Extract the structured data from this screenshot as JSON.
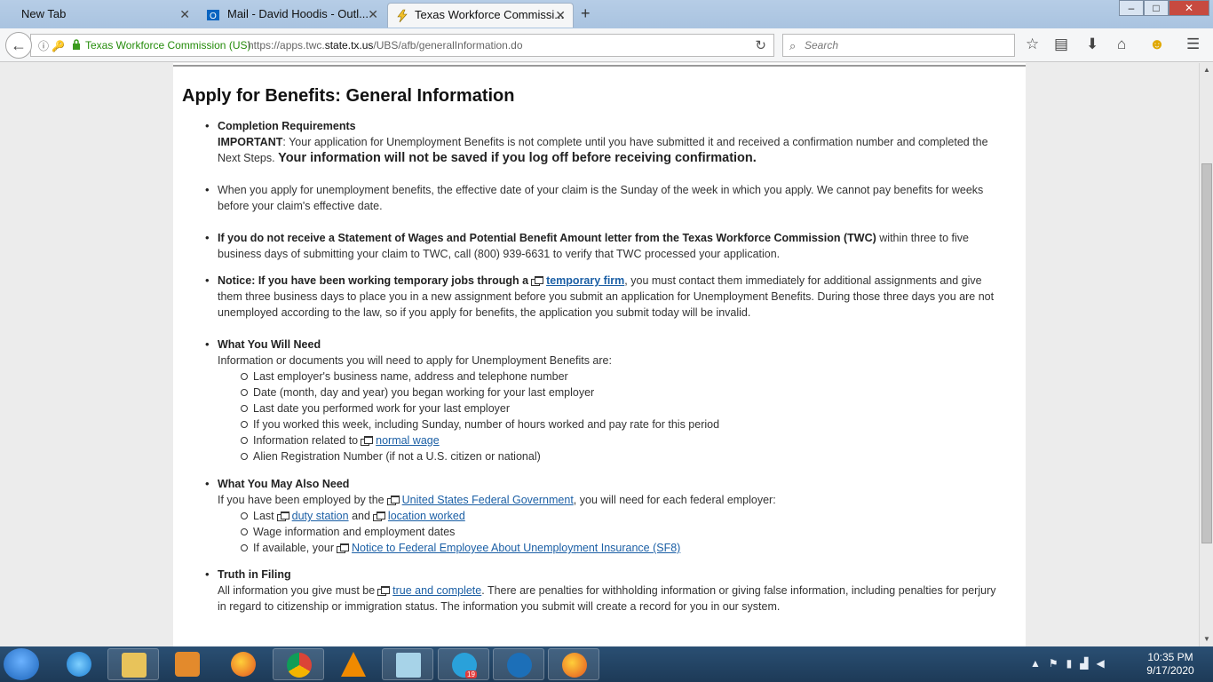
{
  "browser": {
    "tabs": [
      {
        "title": "New Tab",
        "active": false
      },
      {
        "title": "Mail - David Hoodis - Outl...",
        "active": false
      },
      {
        "title": "Texas Workforce Commissi...",
        "active": true
      }
    ],
    "new_tab": "+",
    "window_controls": {
      "minimize": "–",
      "maximize": "□",
      "close": "✕"
    },
    "url_identity": "Texas Workforce Commission (US)",
    "url_prefix": "https://apps.twc.",
    "url_domain": "state.tx.us",
    "url_path": "/UBS/afb/generalInformation.do",
    "search_placeholder": "Search",
    "icons": [
      "back-icon",
      "info-icon",
      "lock-icon",
      "reload-icon",
      "search-icon",
      "bookmark-star-icon",
      "reader-icon",
      "download-icon",
      "home-icon",
      "emoji-icon",
      "menu-icon"
    ]
  },
  "page": {
    "title": "Apply for Benefits: General Information",
    "completion": {
      "heading": "Completion Requirements",
      "important_label": "IMPORTANT",
      "important_text": ": Your application for Unemployment Benefits is not complete until you have submitted it and received a confirmation number and completed the Next Steps.",
      "warning": "Your information will not be saved if you log off before receiving confirmation."
    },
    "effective_date": "When you apply for unemployment benefits, the effective date of your claim is the Sunday of the week in which you apply. We cannot pay benefits for weeks before your claim's effective date.",
    "wages": {
      "bold": "If you do not receive a Statement of Wages and Potential Benefit Amount letter from the Texas Workforce Commission (TWC)",
      "rest": "within three to five business days of submitting your claim to TWC, call (800) 939-6631 to verify that TWC processed your application."
    },
    "notice": {
      "bold": "Notice: If you have been working temporary jobs through a",
      "link": "temporary firm",
      "rest": ", you must contact them immediately for additional assignments and give them three business days to place you in a new assignment before you submit an application for Unemployment Benefits. During those three days you are not unemployed according to the law, so if you apply for benefits, the application you submit today will be invalid."
    },
    "need": {
      "heading": "What You Will Need",
      "intro": "Information or documents you will need to apply for Unemployment Benefits are:",
      "items": [
        "Last employer's business name, address and telephone number",
        "Date (month, day and year) you began working for your last employer",
        "Last date you performed work for your last employer",
        "If you worked this week, including Sunday, number of hours worked and pay rate for this period"
      ],
      "wage_prefix": "Information related to",
      "wage_link": "normal wage",
      "alien": "Alien Registration Number (if not a U.S. citizen or national)"
    },
    "also_need": {
      "heading": "What You May Also Need",
      "intro_prefix": "If you have been employed by the",
      "intro_link": "United States Federal Government",
      "intro_suffix": ", you will need for each federal employer:",
      "last_prefix": "Last",
      "duty_link": "duty station",
      "and": "and",
      "location_link": "location worked",
      "wage_info": "Wage information and employment dates",
      "sf8_prefix": "If available, your",
      "sf8_link": "Notice to Federal Employee About Unemployment Insurance (SF8)"
    },
    "truth": {
      "heading": "Truth in Filing",
      "prefix": "All information you give must be",
      "link": "true and complete",
      "rest": ". There are penalties for withholding information or giving false information, including penalties for perjury in regard to citizenship or immigration status. The information you submit will create a record for you in our system."
    }
  },
  "taskbar": {
    "apps": [
      "internet-explorer",
      "file-explorer",
      "media-player",
      "firefox",
      "chrome",
      "vlc",
      "notepad",
      "telegram",
      "remote-app",
      "firefox-active"
    ],
    "telegram_badge": "19",
    "time": "10:35 PM",
    "date": "9/17/2020"
  }
}
